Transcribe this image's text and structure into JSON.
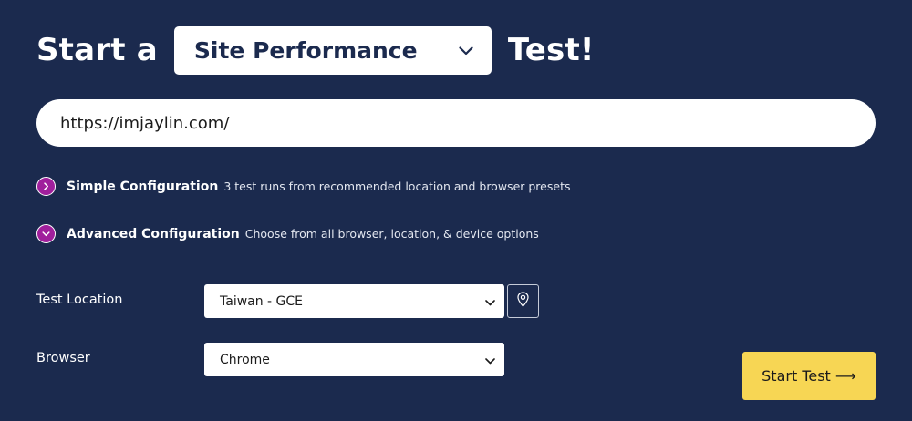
{
  "headline": {
    "prefix": "Start a",
    "suffix": "Test!",
    "test_type_selected": "Site Performance"
  },
  "url_input": {
    "value": "https://imjaylin.com/"
  },
  "config": {
    "simple": {
      "title": "Simple Configuration",
      "description": "3 test runs from recommended location and browser presets",
      "expanded": false
    },
    "advanced": {
      "title": "Advanced Configuration",
      "description": "Choose from all browser, location, & device options",
      "expanded": true
    }
  },
  "form": {
    "location_label": "Test Location",
    "location_value": "Taiwan - GCE",
    "browser_label": "Browser",
    "browser_value": "Chrome"
  },
  "actions": {
    "start_label": "Start Test ⟶"
  },
  "icons": {
    "test_type_dropdown": "chevron-down-icon",
    "simple_toggle": "chevron-right-icon",
    "advanced_toggle": "chevron-down-icon",
    "location_dropdown": "chevron-down-icon",
    "browser_dropdown": "chevron-down-icon",
    "map": "map-pin-icon"
  },
  "colors": {
    "background": "#1b2a4e",
    "accent_purple": "#a01f9c",
    "button_yellow": "#f7d654",
    "text_dark": "#1b2a4e"
  }
}
